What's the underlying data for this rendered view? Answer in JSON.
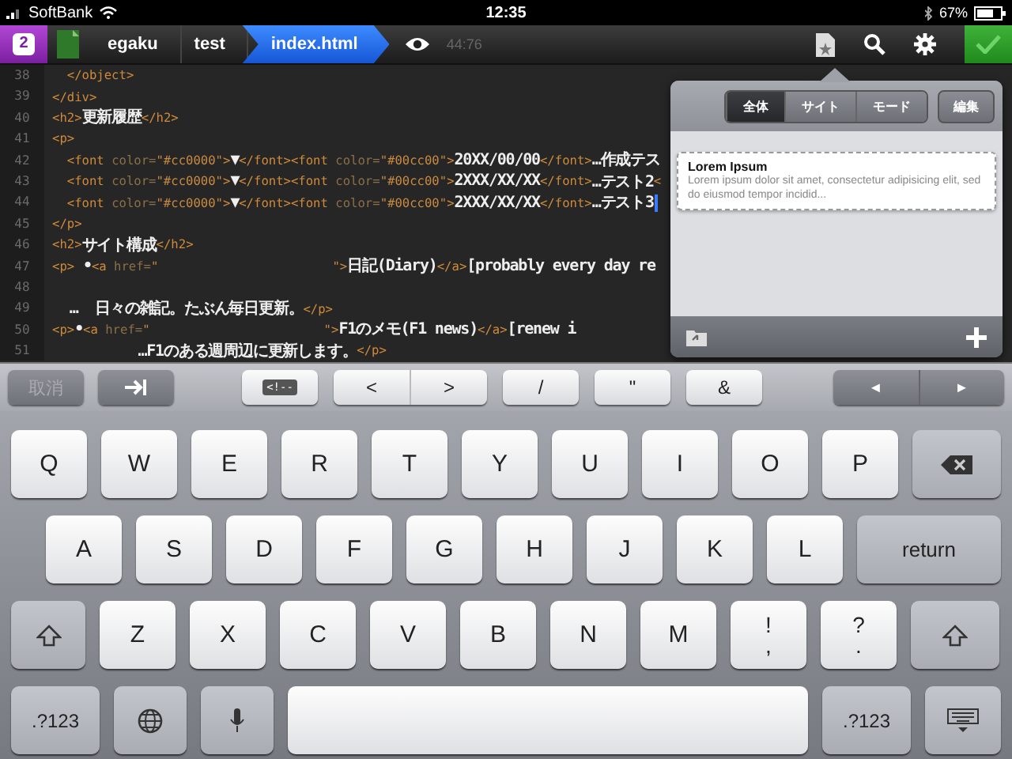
{
  "status_bar": {
    "carrier": "SoftBank",
    "time": "12:35",
    "battery": "67%"
  },
  "toolbar": {
    "badge": "2",
    "breadcrumbs": [
      {
        "label": "egaku",
        "selected": false
      },
      {
        "label": "test",
        "selected": false
      },
      {
        "label": "index.html",
        "selected": true
      }
    ],
    "position": "44:76"
  },
  "editor": {
    "lines": [
      {
        "number": "38",
        "tokens": [
          {
            "kind": "tag",
            "text": "  </object>"
          }
        ]
      },
      {
        "number": "39",
        "tokens": [
          {
            "kind": "tag",
            "text": "</div>"
          }
        ]
      },
      {
        "number": "40",
        "tokens": [
          {
            "kind": "tag",
            "text": "<h2>"
          },
          {
            "kind": "text",
            "text": "更新履歴"
          },
          {
            "kind": "tag",
            "text": "</h2>"
          }
        ]
      },
      {
        "number": "41",
        "tokens": [
          {
            "kind": "tag",
            "text": "<p>"
          }
        ]
      },
      {
        "number": "42",
        "tokens": [
          {
            "kind": "tag",
            "text": "  <font "
          },
          {
            "kind": "attr",
            "text": "color="
          },
          {
            "kind": "string",
            "text": "\"#cc0000\""
          },
          {
            "kind": "tag",
            "text": ">"
          },
          {
            "kind": "text",
            "text": "▼"
          },
          {
            "kind": "tag",
            "text": "</font><font "
          },
          {
            "kind": "attr",
            "text": "color="
          },
          {
            "kind": "string",
            "text": "\"#00cc00\""
          },
          {
            "kind": "tag",
            "text": ">"
          },
          {
            "kind": "text",
            "text": "20XX/00/00"
          },
          {
            "kind": "tag",
            "text": "</font>"
          },
          {
            "kind": "text",
            "text": "…作成テス"
          }
        ]
      },
      {
        "number": "43",
        "tokens": [
          {
            "kind": "tag",
            "text": "  <font "
          },
          {
            "kind": "attr",
            "text": "color="
          },
          {
            "kind": "string",
            "text": "\"#cc0000\""
          },
          {
            "kind": "tag",
            "text": ">"
          },
          {
            "kind": "text",
            "text": "▼"
          },
          {
            "kind": "tag",
            "text": "</font><font "
          },
          {
            "kind": "attr",
            "text": "color="
          },
          {
            "kind": "string",
            "text": "\"#00cc00\""
          },
          {
            "kind": "tag",
            "text": ">"
          },
          {
            "kind": "text",
            "text": "2XXX/XX/XX"
          },
          {
            "kind": "tag",
            "text": "</font>"
          },
          {
            "kind": "text",
            "text": "…テスト2"
          },
          {
            "kind": "tag",
            "text": "<"
          }
        ]
      },
      {
        "number": "44",
        "tokens": [
          {
            "kind": "tag",
            "text": "  <font "
          },
          {
            "kind": "attr",
            "text": "color="
          },
          {
            "kind": "string",
            "text": "\"#cc0000\""
          },
          {
            "kind": "tag",
            "text": ">"
          },
          {
            "kind": "text",
            "text": "▼"
          },
          {
            "kind": "tag",
            "text": "</font><font "
          },
          {
            "kind": "attr",
            "text": "color="
          },
          {
            "kind": "string",
            "text": "\"#00cc00\""
          },
          {
            "kind": "tag",
            "text": ">"
          },
          {
            "kind": "text",
            "text": "2XXX/XX/XX"
          },
          {
            "kind": "tag",
            "text": "</font>"
          },
          {
            "kind": "text",
            "text": "…テスト3"
          },
          {
            "kind": "cursor"
          }
        ]
      },
      {
        "number": "45",
        "tokens": [
          {
            "kind": "tag",
            "text": "</p>"
          }
        ]
      },
      {
        "number": "46",
        "tokens": [
          {
            "kind": "tag",
            "text": "<h2>"
          },
          {
            "kind": "text",
            "text": "サイト構成"
          },
          {
            "kind": "tag",
            "text": "</h2>"
          }
        ]
      },
      {
        "number": "47",
        "tokens": [
          {
            "kind": "tag",
            "text": "<p>"
          },
          {
            "kind": "text",
            "text": " •"
          },
          {
            "kind": "tag",
            "text": "<a "
          },
          {
            "kind": "attr",
            "text": "href="
          },
          {
            "kind": "string",
            "text": "\""
          },
          {
            "kind": "gap"
          },
          {
            "kind": "string",
            "text": "\">"
          },
          {
            "kind": "text",
            "text": "日記(Diary)"
          },
          {
            "kind": "tag",
            "text": "</a>"
          },
          {
            "kind": "text",
            "text": "[probably every day re"
          }
        ]
      },
      {
        "number": "48"
      },
      {
        "number": "49",
        "tokens": [
          {
            "kind": "text",
            "text": "  …  日々の雑記。たぶん毎日更新。"
          },
          {
            "kind": "tag",
            "text": "</p>"
          }
        ]
      },
      {
        "number": "50",
        "tokens": [
          {
            "kind": "tag",
            "text": "<p>"
          },
          {
            "kind": "text",
            "text": "•"
          },
          {
            "kind": "tag",
            "text": "<a "
          },
          {
            "kind": "attr",
            "text": "href="
          },
          {
            "kind": "string",
            "text": "\""
          },
          {
            "kind": "gap"
          },
          {
            "kind": "string",
            "text": "\">"
          },
          {
            "kind": "text",
            "text": "F1のメモ(F1 news)"
          },
          {
            "kind": "tag",
            "text": "</a>"
          },
          {
            "kind": "text",
            "text": "[renew i"
          }
        ]
      },
      {
        "number": "51",
        "tokens": [
          {
            "kind": "text",
            "text": "          …F1のある週周辺に更新します。"
          },
          {
            "kind": "tag",
            "text": "</p>"
          }
        ]
      }
    ]
  },
  "popover": {
    "tabs": [
      {
        "label": "全体",
        "selected": true
      },
      {
        "label": "サイト",
        "selected": false
      },
      {
        "label": "モード",
        "selected": false
      }
    ],
    "edit_button": "編集",
    "items": [
      {
        "title": "Lorem Ipsum",
        "description": "Lorem ipsum dolor sit amet, consectetur adipisicing elit, sed do eiusmod tempor incidid..."
      }
    ]
  },
  "accessory_bar": {
    "cancel": {
      "label": "取消",
      "disabled": true
    },
    "keys": [
      {
        "kind": "tab"
      },
      {
        "kind": "comment",
        "label": "<!--"
      },
      {
        "kind": "pair",
        "labels": [
          "<",
          ">"
        ]
      },
      {
        "kind": "key",
        "label": "/"
      },
      {
        "kind": "key",
        "label": "\""
      },
      {
        "kind": "key",
        "label": "&"
      },
      {
        "kind": "arrows",
        "labels": [
          "◄",
          "►"
        ]
      }
    ]
  },
  "keyboard": {
    "rows": [
      {
        "keys": [
          {
            "kind": "letter",
            "label": "Q"
          },
          {
            "kind": "letter",
            "label": "W"
          },
          {
            "kind": "letter",
            "label": "E"
          },
          {
            "kind": "letter",
            "label": "R"
          },
          {
            "kind": "letter",
            "label": "T"
          },
          {
            "kind": "letter",
            "label": "Y"
          },
          {
            "kind": "letter",
            "label": "U"
          },
          {
            "kind": "letter",
            "label": "I"
          },
          {
            "kind": "letter",
            "label": "O"
          },
          {
            "kind": "letter",
            "label": "P"
          },
          {
            "kind": "backspace"
          }
        ]
      },
      {
        "keys": [
          {
            "kind": "letter",
            "label": "A"
          },
          {
            "kind": "letter",
            "label": "S"
          },
          {
            "kind": "letter",
            "label": "D"
          },
          {
            "kind": "letter",
            "label": "F"
          },
          {
            "kind": "letter",
            "label": "G"
          },
          {
            "kind": "letter",
            "label": "H"
          },
          {
            "kind": "letter",
            "label": "J"
          },
          {
            "kind": "letter",
            "label": "K"
          },
          {
            "kind": "letter",
            "label": "L"
          },
          {
            "kind": "return",
            "label": "return"
          }
        ]
      },
      {
        "keys": [
          {
            "kind": "shift"
          },
          {
            "kind": "letter",
            "label": "Z"
          },
          {
            "kind": "letter",
            "label": "X"
          },
          {
            "kind": "letter",
            "label": "C"
          },
          {
            "kind": "letter",
            "label": "V"
          },
          {
            "kind": "letter",
            "label": "B"
          },
          {
            "kind": "letter",
            "label": "N"
          },
          {
            "kind": "letter",
            "label": "M"
          },
          {
            "kind": "symbol",
            "labels": [
              "!",
              ","
            ]
          },
          {
            "kind": "symbol",
            "labels": [
              "?",
              "."
            ]
          },
          {
            "kind": "shift"
          }
        ]
      },
      {
        "keys": [
          {
            "kind": "numbers",
            "label": ".?123"
          },
          {
            "kind": "globe"
          },
          {
            "kind": "mic"
          },
          {
            "kind": "space"
          },
          {
            "kind": "numbers",
            "label": ".?123"
          },
          {
            "kind": "hide"
          }
        ]
      }
    ]
  }
}
